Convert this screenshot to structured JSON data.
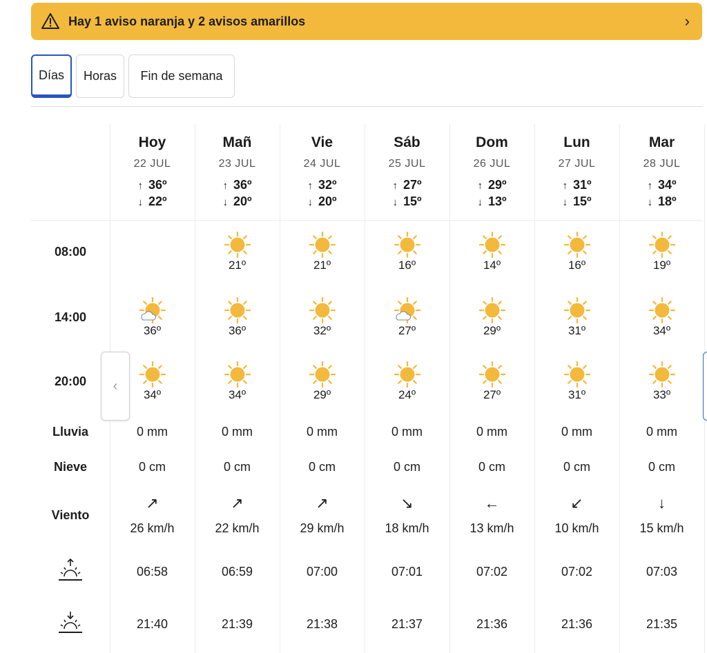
{
  "alert": {
    "text": "Hay 1 aviso naranja y 2 avisos amarillos"
  },
  "tabs": [
    {
      "label": "Días"
    },
    {
      "label": "Horas"
    },
    {
      "label": "Fin de semana"
    }
  ],
  "rows": {
    "times": [
      "08:00",
      "14:00",
      "20:00"
    ],
    "rain_label": "Lluvia",
    "snow_label": "Nieve",
    "wind_label": "Viento"
  },
  "days": [
    {
      "name": "Hoy",
      "date": "22 JUL",
      "max": "36º",
      "min": "22º",
      "t08": "",
      "t14": "36º",
      "t20": "34º",
      "i08": "none",
      "i14": "sun-cloud",
      "i20": "sun",
      "rain": "0 mm",
      "snow": "0 cm",
      "wind_arrow": "↗",
      "wind": "26 km/h",
      "sunrise": "06:58",
      "sunset": "21:40"
    },
    {
      "name": "Mañ",
      "date": "23 JUL",
      "max": "36º",
      "min": "20º",
      "t08": "21º",
      "t14": "36º",
      "t20": "34º",
      "i08": "sun",
      "i14": "sun",
      "i20": "sun",
      "rain": "0 mm",
      "snow": "0 cm",
      "wind_arrow": "↗",
      "wind": "22 km/h",
      "sunrise": "06:59",
      "sunset": "21:39"
    },
    {
      "name": "Vie",
      "date": "24 JUL",
      "max": "32º",
      "min": "20º",
      "t08": "21º",
      "t14": "32º",
      "t20": "29º",
      "i08": "sun",
      "i14": "sun",
      "i20": "sun",
      "rain": "0 mm",
      "snow": "0 cm",
      "wind_arrow": "↗",
      "wind": "29 km/h",
      "sunrise": "07:00",
      "sunset": "21:38"
    },
    {
      "name": "Sáb",
      "date": "25 JUL",
      "max": "27º",
      "min": "15º",
      "t08": "16º",
      "t14": "27º",
      "t20": "24º",
      "i08": "sun",
      "i14": "sun-cloud",
      "i20": "sun",
      "rain": "0 mm",
      "snow": "0 cm",
      "wind_arrow": "↘",
      "wind": "18 km/h",
      "sunrise": "07:01",
      "sunset": "21:37"
    },
    {
      "name": "Dom",
      "date": "26 JUL",
      "max": "29º",
      "min": "13º",
      "t08": "14º",
      "t14": "29º",
      "t20": "27º",
      "i08": "sun",
      "i14": "sun",
      "i20": "sun",
      "rain": "0 mm",
      "snow": "0 cm",
      "wind_arrow": "←",
      "wind": "13 km/h",
      "sunrise": "07:02",
      "sunset": "21:36"
    },
    {
      "name": "Lun",
      "date": "27 JUL",
      "max": "31º",
      "min": "15º",
      "t08": "16º",
      "t14": "31º",
      "t20": "31º",
      "i08": "sun",
      "i14": "sun",
      "i20": "sun",
      "rain": "0 mm",
      "snow": "0 cm",
      "wind_arrow": "↙",
      "wind": "10 km/h",
      "sunrise": "07:02",
      "sunset": "21:36"
    },
    {
      "name": "Mar",
      "date": "28 JUL",
      "max": "34º",
      "min": "18º",
      "t08": "19º",
      "t14": "34º",
      "t20": "33º",
      "i08": "sun",
      "i14": "sun",
      "i20": "sun",
      "rain": "0 mm",
      "snow": "0 cm",
      "wind_arrow": "↓",
      "wind": "15 km/h",
      "sunrise": "07:03",
      "sunset": "21:35"
    }
  ],
  "colors": {
    "alert": "#f2b93d",
    "accent": "#2754c5",
    "sun": "#f2b93d"
  }
}
